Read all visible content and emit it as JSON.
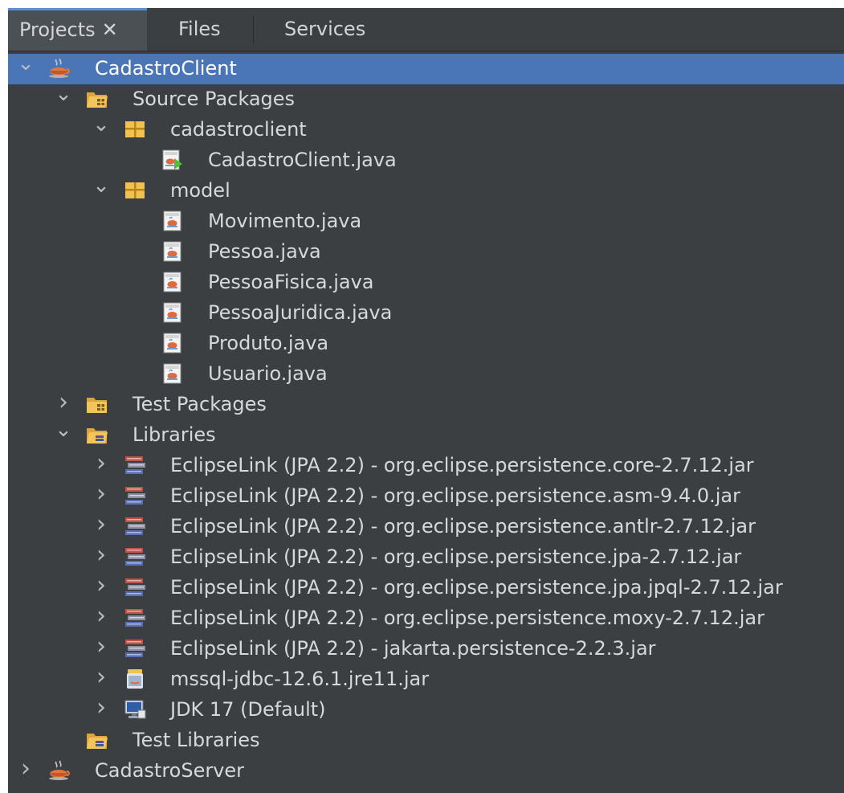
{
  "tabs": [
    {
      "label": "Projects",
      "close": "✕",
      "active": true
    },
    {
      "label": "Files",
      "active": false
    },
    {
      "label": "Services",
      "active": false
    }
  ],
  "tree": [
    {
      "label": "CadastroClient",
      "level": 0,
      "arrow": "expanded",
      "icon": "java-project-icon",
      "selected": true
    },
    {
      "label": "Source Packages",
      "level": 1,
      "arrow": "expanded",
      "icon": "source-folder-icon"
    },
    {
      "label": "cadastroclient",
      "level": 2,
      "arrow": "expanded",
      "icon": "package-icon"
    },
    {
      "label": "CadastroClient.java",
      "level": 3,
      "arrow": "none",
      "icon": "java-main-class-icon"
    },
    {
      "label": "model",
      "level": 2,
      "arrow": "expanded",
      "icon": "package-icon"
    },
    {
      "label": "Movimento.java",
      "level": 3,
      "arrow": "none",
      "icon": "java-class-icon"
    },
    {
      "label": "Pessoa.java",
      "level": 3,
      "arrow": "none",
      "icon": "java-class-icon"
    },
    {
      "label": "PessoaFisica.java",
      "level": 3,
      "arrow": "none",
      "icon": "java-class-icon"
    },
    {
      "label": "PessoaJuridica.java",
      "level": 3,
      "arrow": "none",
      "icon": "java-class-icon"
    },
    {
      "label": "Produto.java",
      "level": 3,
      "arrow": "none",
      "icon": "java-class-icon"
    },
    {
      "label": "Usuario.java",
      "level": 3,
      "arrow": "none",
      "icon": "java-class-icon"
    },
    {
      "label": "Test Packages",
      "level": 1,
      "arrow": "collapsed",
      "icon": "test-folder-icon"
    },
    {
      "label": "Libraries",
      "level": 1,
      "arrow": "expanded",
      "icon": "libraries-folder-icon"
    },
    {
      "label": "EclipseLink (JPA 2.2) - org.eclipse.persistence.core-2.7.12.jar",
      "level": 2,
      "arrow": "collapsed",
      "icon": "library-jar-icon"
    },
    {
      "label": "EclipseLink (JPA 2.2) - org.eclipse.persistence.asm-9.4.0.jar",
      "level": 2,
      "arrow": "collapsed",
      "icon": "library-jar-icon"
    },
    {
      "label": "EclipseLink (JPA 2.2) - org.eclipse.persistence.antlr-2.7.12.jar",
      "level": 2,
      "arrow": "collapsed",
      "icon": "library-jar-icon"
    },
    {
      "label": "EclipseLink (JPA 2.2) - org.eclipse.persistence.jpa-2.7.12.jar",
      "level": 2,
      "arrow": "collapsed",
      "icon": "library-jar-icon"
    },
    {
      "label": "EclipseLink (JPA 2.2) - org.eclipse.persistence.jpa.jpql-2.7.12.jar",
      "level": 2,
      "arrow": "collapsed",
      "icon": "library-jar-icon"
    },
    {
      "label": "EclipseLink (JPA 2.2) - org.eclipse.persistence.moxy-2.7.12.jar",
      "level": 2,
      "arrow": "collapsed",
      "icon": "library-jar-icon"
    },
    {
      "label": "EclipseLink (JPA 2.2) - jakarta.persistence-2.2.3.jar",
      "level": 2,
      "arrow": "collapsed",
      "icon": "library-jar-icon"
    },
    {
      "label": "mssql-jdbc-12.6.1.jre11.jar",
      "level": 2,
      "arrow": "collapsed",
      "icon": "jar-file-icon"
    },
    {
      "label": "JDK 17 (Default)",
      "level": 2,
      "arrow": "collapsed",
      "icon": "jdk-icon"
    },
    {
      "label": "Test Libraries",
      "level": 1,
      "arrow": "none",
      "icon": "libraries-folder-icon"
    },
    {
      "label": "CadastroServer",
      "level": 0,
      "arrow": "collapsed",
      "icon": "java-project-icon"
    }
  ],
  "colors": {
    "background": "#3c3f41",
    "selection": "#4a76b8",
    "active_tab_indicator": "#5a8fd8",
    "text": "#d6d8da"
  }
}
